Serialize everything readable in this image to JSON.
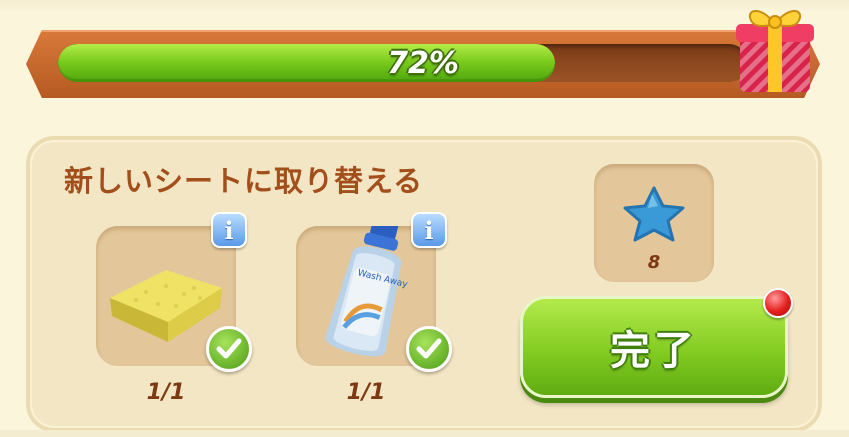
{
  "progress": {
    "percent_label": "72%",
    "fraction": 0.72
  },
  "task": {
    "title": "新しいシートに取り替える",
    "items": [
      {
        "icon": "sponge-icon",
        "count": "1/1",
        "completed": true
      },
      {
        "icon": "detergent-bottle-icon",
        "count": "1/1",
        "completed": true
      }
    ],
    "bottle_label": "Wash Away"
  },
  "reward": {
    "icon": "blue-star-icon",
    "count": "8"
  },
  "done_button": {
    "label": "完了",
    "has_notification": true
  },
  "colors": {
    "progress_green": "#7ccc1e",
    "title_brown": "#a34f1c",
    "button_green": "#84cc22",
    "notification_red": "#e51e1e"
  }
}
